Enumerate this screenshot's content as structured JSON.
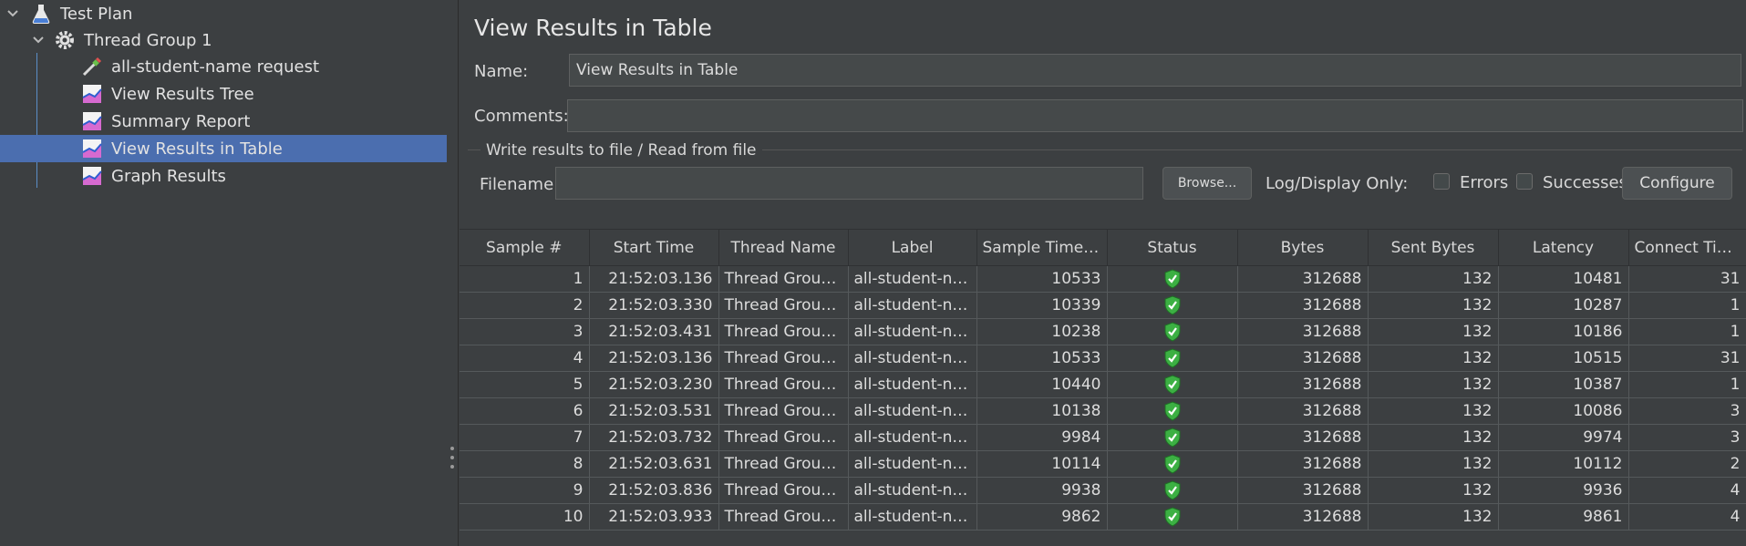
{
  "tree": {
    "items": [
      {
        "label": "Test Plan",
        "icon": "flask-icon",
        "depth": 0,
        "expanded": true
      },
      {
        "label": "Thread Group 1",
        "icon": "gear-icon",
        "depth": 1,
        "expanded": true
      },
      {
        "label": "all-student-name request",
        "icon": "pipette-icon",
        "depth": 2
      },
      {
        "label": "View Results Tree",
        "icon": "chart-icon",
        "depth": 2
      },
      {
        "label": "Summary Report",
        "icon": "chart-icon",
        "depth": 2
      },
      {
        "label": "View Results in Table",
        "icon": "chart-icon",
        "depth": 2,
        "selected": true
      },
      {
        "label": "Graph Results",
        "icon": "chart-icon",
        "depth": 2
      }
    ]
  },
  "panel": {
    "title": "View Results in Table",
    "name_label": "Name:",
    "name_value": "View Results in Table",
    "comments_label": "Comments:",
    "comments_value": "",
    "file_section_title": "Write results to file / Read from file",
    "filename_label": "Filename",
    "filename_value": "",
    "browse_label": "Browse...",
    "log_display_label": "Log/Display Only:",
    "errors_label": "Errors",
    "successes_label": "Successes",
    "configure_label": "Configure"
  },
  "table": {
    "columns": [
      "Sample #",
      "Start Time",
      "Thread Name",
      "Label",
      "Sample Time(...",
      "Status",
      "Bytes",
      "Sent Bytes",
      "Latency",
      "Connect Time(..."
    ],
    "rows": [
      [
        "1",
        "21:52:03.136",
        "Thread Group ...",
        "all-student-na...",
        "10533",
        "success",
        "312688",
        "132",
        "10481",
        "31"
      ],
      [
        "2",
        "21:52:03.330",
        "Thread Group ...",
        "all-student-na...",
        "10339",
        "success",
        "312688",
        "132",
        "10287",
        "1"
      ],
      [
        "3",
        "21:52:03.431",
        "Thread Group ...",
        "all-student-na...",
        "10238",
        "success",
        "312688",
        "132",
        "10186",
        "1"
      ],
      [
        "4",
        "21:52:03.136",
        "Thread Group ...",
        "all-student-na...",
        "10533",
        "success",
        "312688",
        "132",
        "10515",
        "31"
      ],
      [
        "5",
        "21:52:03.230",
        "Thread Group ...",
        "all-student-na...",
        "10440",
        "success",
        "312688",
        "132",
        "10387",
        "1"
      ],
      [
        "6",
        "21:52:03.531",
        "Thread Group ...",
        "all-student-na...",
        "10138",
        "success",
        "312688",
        "132",
        "10086",
        "3"
      ],
      [
        "7",
        "21:52:03.732",
        "Thread Group ...",
        "all-student-na...",
        "9984",
        "success",
        "312688",
        "132",
        "9974",
        "3"
      ],
      [
        "8",
        "21:52:03.631",
        "Thread Group ...",
        "all-student-na...",
        "10114",
        "success",
        "312688",
        "132",
        "10112",
        "2"
      ],
      [
        "9",
        "21:52:03.836",
        "Thread Group ...",
        "all-student-na...",
        "9938",
        "success",
        "312688",
        "132",
        "9936",
        "4"
      ],
      [
        "10",
        "21:52:03.933",
        "Thread Group ...",
        "all-student-na...",
        "9862",
        "success",
        "312688",
        "132",
        "9861",
        "4"
      ]
    ]
  },
  "colors": {
    "background": "#3c3f41",
    "selection": "#4b6eaf",
    "success": "#3cb043"
  }
}
